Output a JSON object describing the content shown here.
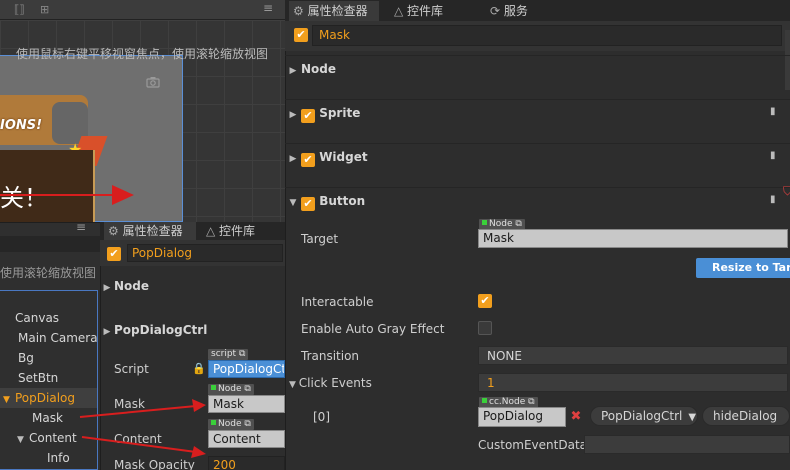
{
  "scene": {
    "menu_glyph": "≡",
    "hint": "使用鼠标右键平移视窗焦点，使用滚轮缩放视图",
    "banner_text": "IONS!",
    "dialog_text": "关！",
    "camera_icon": "camera-icon",
    "tool_glyphs": [
      "⟦⟧",
      "⊞"
    ]
  },
  "hierarchy": {
    "menu_glyph": "≡",
    "hint": "使用滚轮缩放视图",
    "items": [
      {
        "label": "Canvas",
        "depth": 0,
        "arrow": ""
      },
      {
        "label": "Main Camera",
        "depth": 1,
        "arrow": ""
      },
      {
        "label": "Bg",
        "depth": 1,
        "arrow": ""
      },
      {
        "label": "SetBtn",
        "depth": 1,
        "arrow": ""
      },
      {
        "label": "PopDialog",
        "depth": 1,
        "arrow": "▼",
        "selected": true
      },
      {
        "label": "Mask",
        "depth": 2,
        "arrow": ""
      },
      {
        "label": "Content",
        "depth": 2,
        "arrow": "▼"
      },
      {
        "label": "Info",
        "depth": 3,
        "arrow": ""
      }
    ]
  },
  "mid_inspector": {
    "tabs": [
      "属性检查器",
      "控件库"
    ],
    "node_name": "PopDialog",
    "node_section": "Node",
    "component_section": "PopDialogCtrl",
    "script_label": "Script",
    "script_tag": "script",
    "script_value": "PopDialogCtrl",
    "mask_label": "Mask",
    "mask_tag": "Node",
    "mask_value": "Mask",
    "content_label": "Content",
    "content_tag": "Node",
    "content_value": "Content",
    "opacity_label": "Mask Opacity",
    "opacity_value": "200"
  },
  "right_inspector": {
    "tabs": [
      "属性检查器",
      "控件库",
      "服务"
    ],
    "node_name": "Mask",
    "sections": {
      "node": "Node",
      "sprite": "Sprite",
      "widget": "Widget",
      "button": "Button"
    },
    "target_label": "Target",
    "target_tag": "Node",
    "target_value": "Mask",
    "resize_button": "Resize to Target",
    "interactable_label": "Interactable",
    "auto_gray_label": "Enable Auto Gray Effect",
    "transition_label": "Transition",
    "transition_value": "NONE",
    "click_events_label": "Click Events",
    "click_events_count": "1",
    "event_index": "[0]",
    "event_tag": "cc.Node",
    "event_node": "PopDialog",
    "event_component": "PopDialogCtrl",
    "event_handler": "hideDialog",
    "custom_data_label": "CustomEventData"
  },
  "colors": {
    "accent": "#f29f1d",
    "selection_blue": "#4a8fd6",
    "annotation_red": "#d81e1e"
  }
}
